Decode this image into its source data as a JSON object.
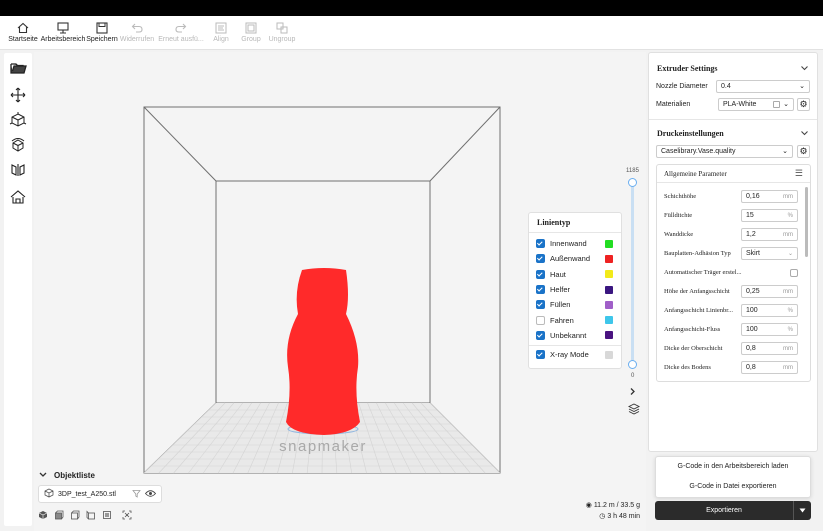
{
  "toolbar": {
    "items": [
      {
        "label": "Startseite",
        "icon": "home-icon",
        "enabled": true
      },
      {
        "label": "Arbeitsbereich",
        "icon": "workspace-icon",
        "enabled": true
      },
      {
        "label": "Speichern",
        "icon": "save-icon",
        "enabled": true
      },
      {
        "label": "Widerrufen",
        "icon": "undo-icon",
        "enabled": false
      },
      {
        "label": "Erneut ausfü...",
        "icon": "redo-icon",
        "enabled": false
      },
      {
        "label": "Align",
        "icon": "align-icon",
        "enabled": false
      },
      {
        "label": "Group",
        "icon": "group-icon",
        "enabled": false
      },
      {
        "label": "Ungroup",
        "icon": "ungroup-icon",
        "enabled": false
      }
    ]
  },
  "left_tools": [
    "open-folder-icon",
    "move-icon",
    "scale-icon",
    "rotate-icon",
    "mirror-icon",
    "support-icon"
  ],
  "viewport": {
    "brand_text": "snapmaker",
    "model_color": "#ff2a2a"
  },
  "legend": {
    "title": "Linientyp",
    "items": [
      {
        "label": "Innenwand",
        "checked": true,
        "color": "#22dd22"
      },
      {
        "label": "Außenwand",
        "checked": true,
        "color": "#ee2222"
      },
      {
        "label": "Haut",
        "checked": true,
        "color": "#f2ea1a"
      },
      {
        "label": "Helfer",
        "checked": true,
        "color": "#3a1680"
      },
      {
        "label": "Füllen",
        "checked": true,
        "color": "#a05fc8"
      },
      {
        "label": "Fahren",
        "checked": false,
        "color": "#3ec6ea"
      },
      {
        "label": "Unbekannt",
        "checked": true,
        "color": "#4a1380"
      }
    ],
    "xray": {
      "label": "X-ray Mode",
      "checked": true,
      "color": "#d8d8d8"
    }
  },
  "layer_slider": {
    "max": "1185",
    "min": "0",
    "upper_fraction": 1.0,
    "lower_fraction": 0.0
  },
  "object_list": {
    "title": "Objektliste",
    "items": [
      {
        "name": "3DP_test_A250.stl"
      }
    ],
    "view_icons": [
      "cube-iso-icon",
      "cube-front-icon",
      "cube-left-icon",
      "cube-right-icon",
      "cube-top-icon",
      "fit-view-icon"
    ]
  },
  "stats": {
    "filament": "11.2 m / 33.5 g",
    "time": "3 h 48 min"
  },
  "extruder": {
    "title": "Extruder Settings",
    "nozzle_label": "Nozzle Diameter",
    "nozzle_value": "0.4",
    "material_label": "Materialien",
    "material_value": "PLA-White"
  },
  "print_settings": {
    "title": "Druckeinstellungen",
    "profile": "Caselibrary.Vase.quality",
    "group_title": "Allgemeine Parameter",
    "params": [
      {
        "label": "Schichthöhe",
        "value": "0,16",
        "unit": "mm",
        "type": "input"
      },
      {
        "label": "Füllditchte",
        "value": "15",
        "unit": "%",
        "type": "input"
      },
      {
        "label": "Wanddicke",
        "value": "1,2",
        "unit": "mm",
        "type": "input"
      },
      {
        "label": "Bauplatten-Adhäsion Typ",
        "value": "Skirt",
        "unit": "",
        "type": "select"
      },
      {
        "label": "Automatischer Träger erstel...",
        "value": "",
        "unit": "",
        "type": "checkbox"
      },
      {
        "label": "Höhe der Anfangsschicht",
        "value": "0,25",
        "unit": "mm",
        "type": "input"
      },
      {
        "label": "Anfangsschicht Linienbr...",
        "value": "100",
        "unit": "%",
        "type": "input"
      },
      {
        "label": "Anfangsschicht-Fluss",
        "value": "100",
        "unit": "%",
        "type": "input"
      },
      {
        "label": "Dicke der Oberschicht",
        "value": "0,8",
        "unit": "mm",
        "type": "input"
      },
      {
        "label": "Dicke des Bodens",
        "value": "0,8",
        "unit": "mm",
        "type": "input"
      }
    ]
  },
  "export": {
    "menu": [
      "G-Code in den Arbeitsbereich laden",
      "G-Code in Datei exportieren"
    ],
    "button_label": "Exportieren"
  }
}
